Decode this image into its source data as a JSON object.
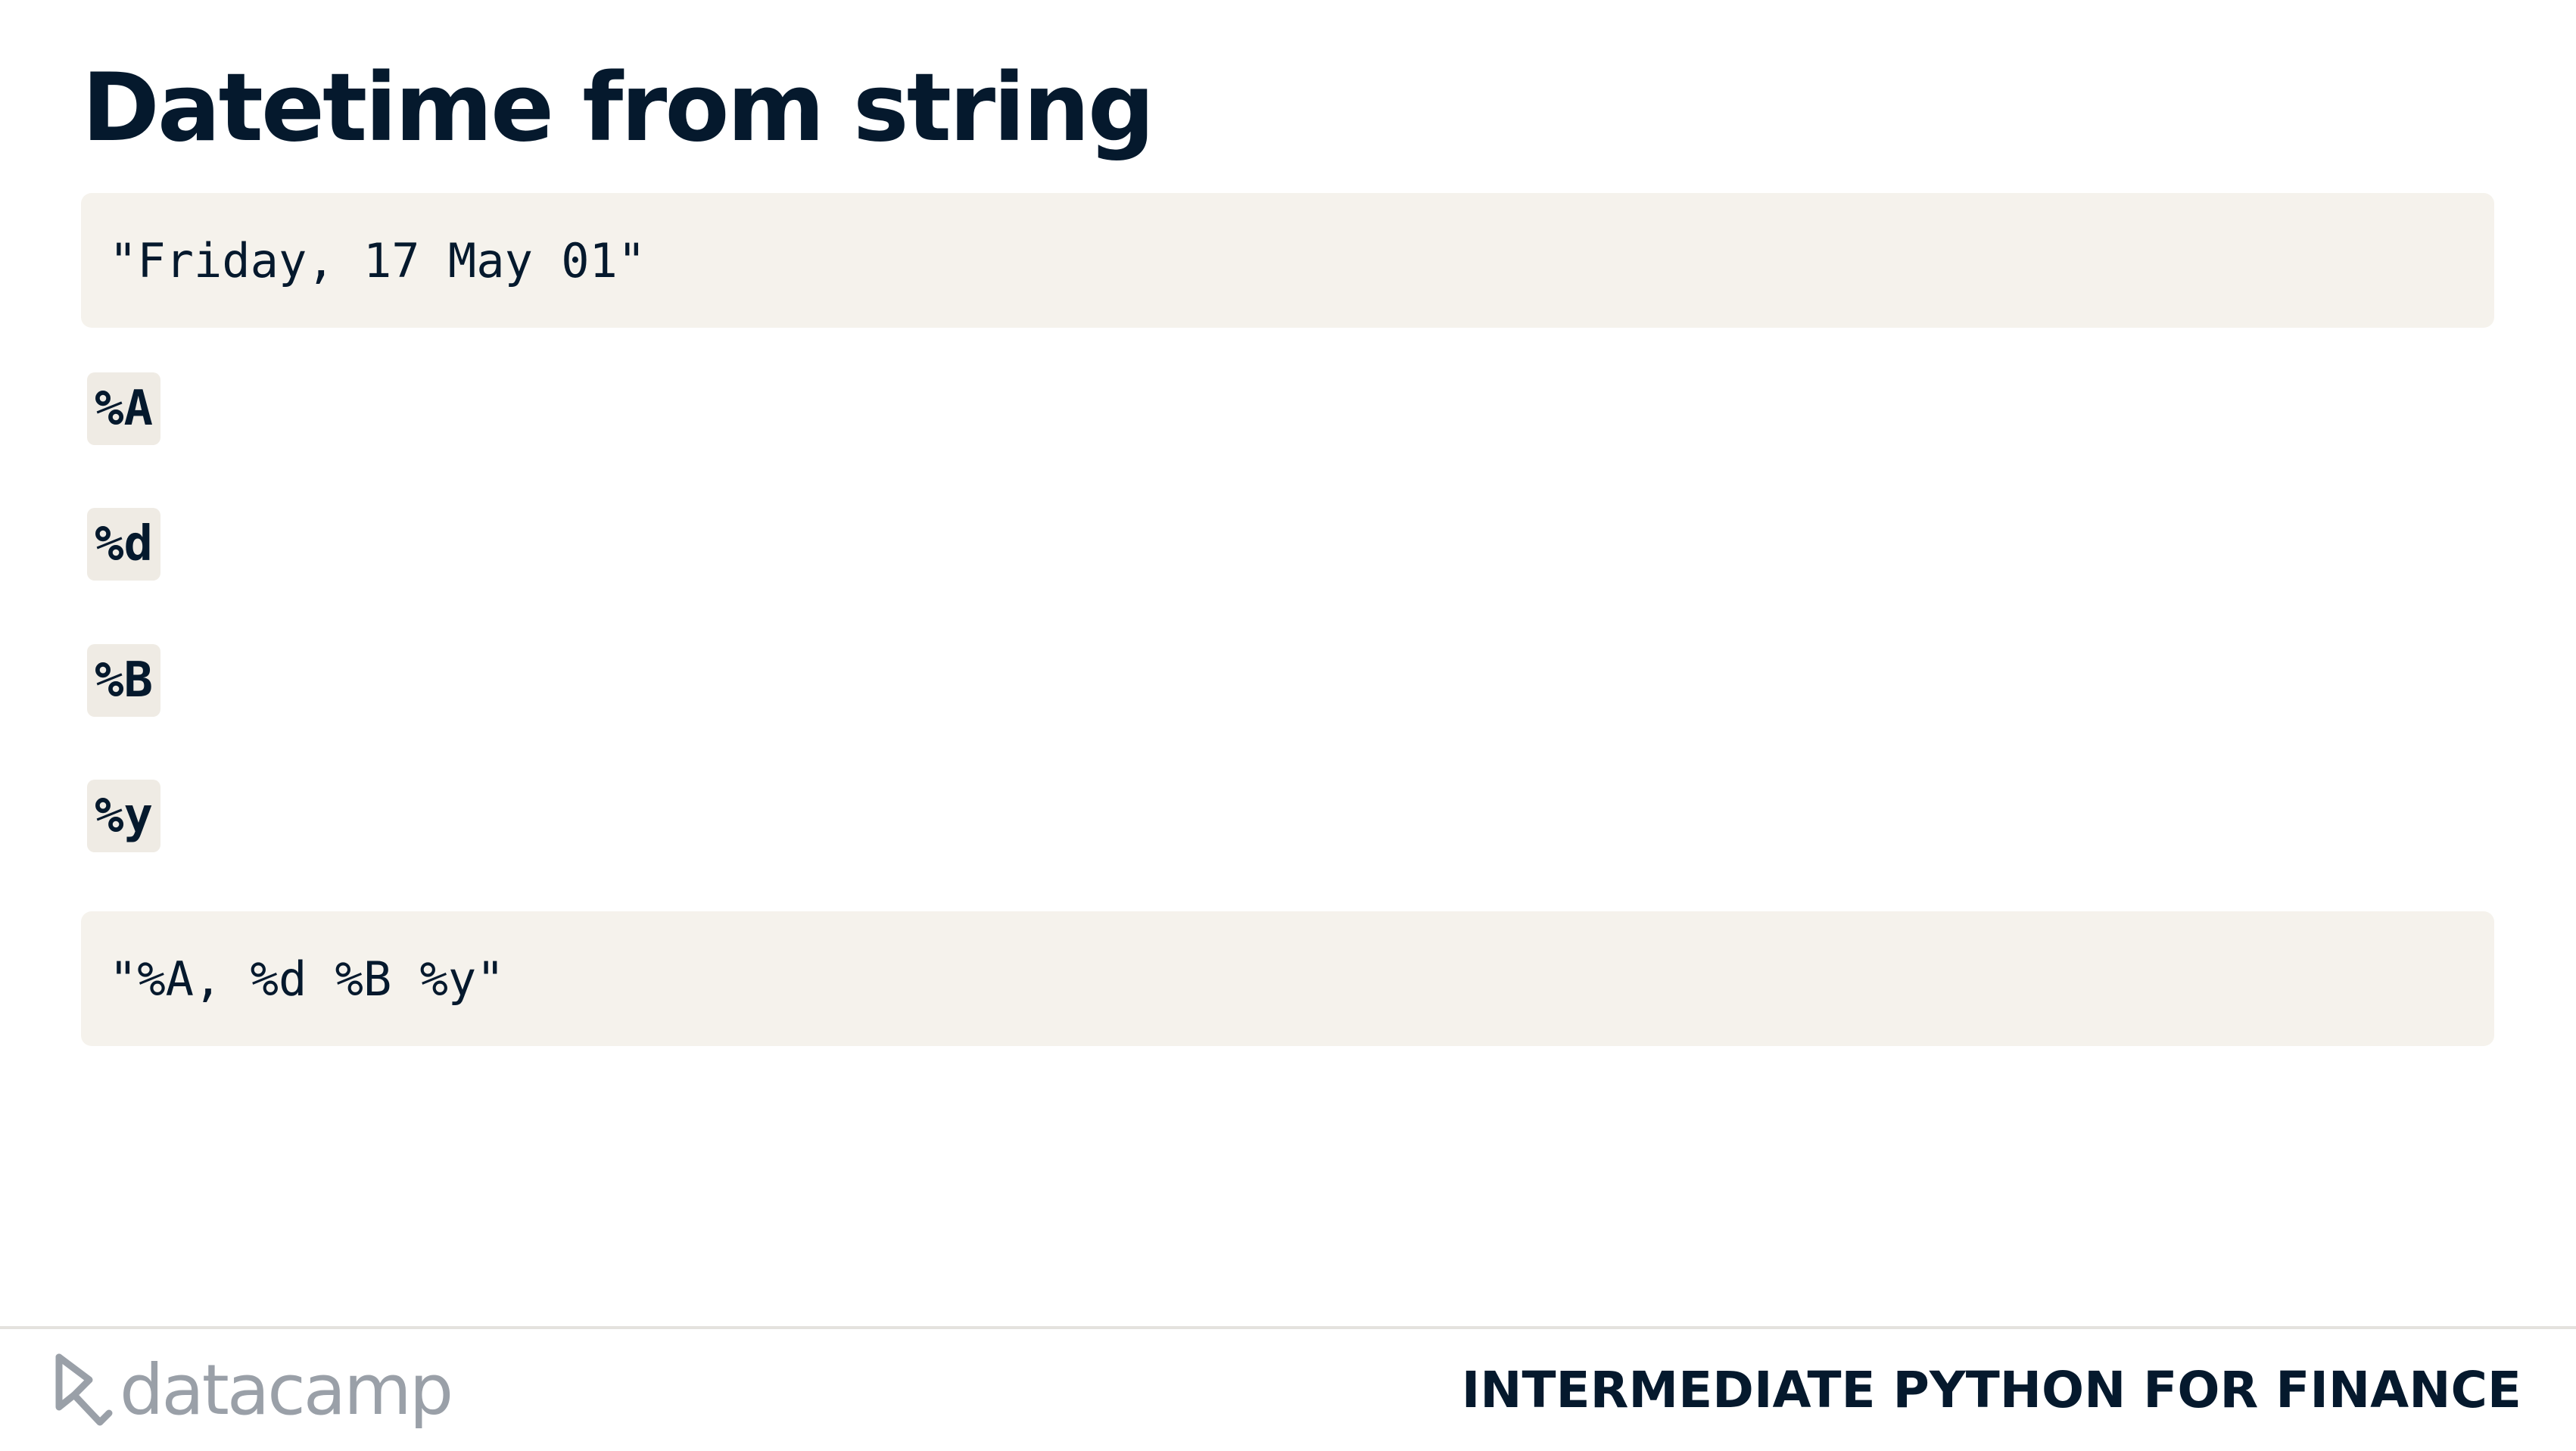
{
  "slide": {
    "title": "Datetime from string",
    "example_string": "\"Friday, 17 May 01\"",
    "format_codes": [
      "%A",
      "%d",
      "%B",
      "%y"
    ],
    "format_string": "\"%A, %d %B %y\""
  },
  "footer": {
    "logo_text": "datacamp",
    "course_title": "INTERMEDIATE PYTHON FOR FINANCE"
  },
  "colors": {
    "text": "#05192d",
    "code_background": "#f5f2ec",
    "inline_code_background": "#efebe4",
    "logo": "#9aa0a8",
    "divider": "#e4e2de"
  }
}
